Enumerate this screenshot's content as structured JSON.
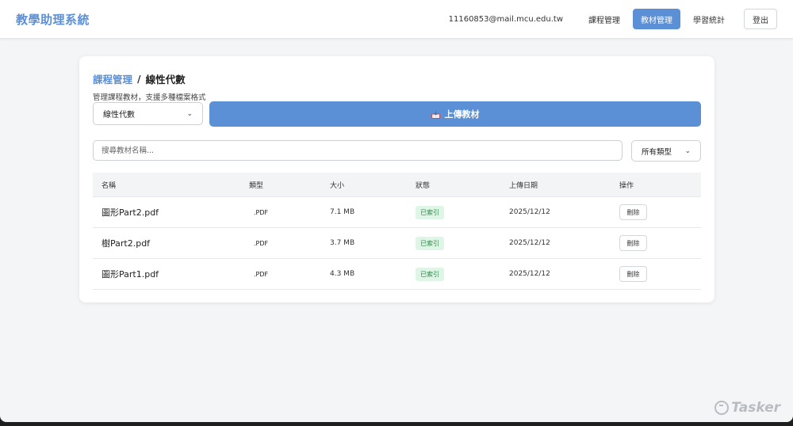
{
  "navbar": {
    "brand": "教學助理系統",
    "email": "11160853@mail.mcu.edu.tw",
    "links": [
      "課程管理",
      "教材管理",
      "學習統計"
    ],
    "active_index": 1,
    "logout": "登出"
  },
  "breadcrumb": {
    "parent": "課程管理",
    "separator": "/",
    "current": "線性代數"
  },
  "subtitle": "管理課程教材，支援多種檔案格式",
  "course_select": {
    "value": "線性代數"
  },
  "upload_button": {
    "label": "上傳教材",
    "icon": "inbox-tray-icon"
  },
  "search": {
    "placeholder": "搜尋教材名稱...",
    "value": ""
  },
  "type_select": {
    "value": "所有類型"
  },
  "table": {
    "headers": [
      "名稱",
      "類型",
      "大小",
      "狀態",
      "上傳日期",
      "操作"
    ],
    "rows": [
      {
        "name": "圖形Part2.pdf",
        "type": ".PDF",
        "size": "7.1 MB",
        "status": "已索引",
        "date": "2025/12/12",
        "action": "刪除"
      },
      {
        "name": "樹Part2.pdf",
        "type": ".PDF",
        "size": "3.7 MB",
        "status": "已索引",
        "date": "2025/12/12",
        "action": "刪除"
      },
      {
        "name": "圖形Part1.pdf",
        "type": ".PDF",
        "size": "4.3 MB",
        "status": "已索引",
        "date": "2025/12/12",
        "action": "刪除"
      }
    ]
  },
  "watermark": "Tasker",
  "colors": {
    "accent": "#5b8fd6",
    "badge_bg": "#dff5e6",
    "badge_text": "#2f8a4b"
  }
}
